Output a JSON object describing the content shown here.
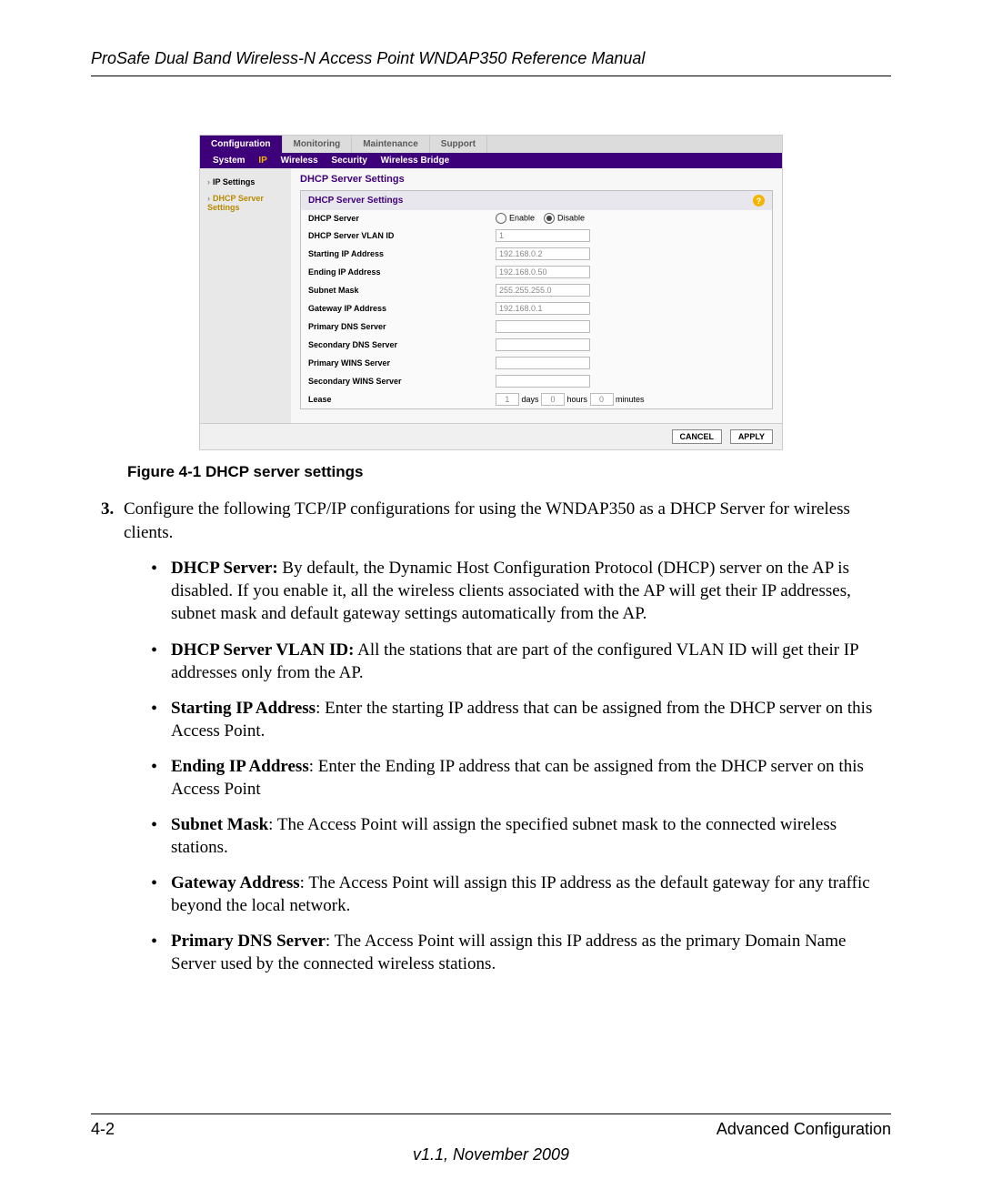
{
  "header": "ProSafe Dual Band Wireless-N Access Point WNDAP350 Reference Manual",
  "shot": {
    "tabs": [
      "Configuration",
      "Monitoring",
      "Maintenance",
      "Support"
    ],
    "tabs_active": 0,
    "subtabs": [
      "System",
      "IP",
      "Wireless",
      "Security",
      "Wireless Bridge"
    ],
    "subtabs_active": 1,
    "sidebar": [
      {
        "label": "IP Settings",
        "selected": false
      },
      {
        "label": "DHCP Server Settings",
        "selected": true
      }
    ],
    "title": "DHCP Server Settings",
    "panel_title": "DHCP Server Settings",
    "rows": {
      "dhcp_server_label": "DHCP Server",
      "enable": "Enable",
      "disable": "Disable",
      "vlan_label": "DHCP Server VLAN ID",
      "vlan_val": "1",
      "start_label": "Starting IP Address",
      "start_val": "192.168.0.2",
      "end_label": "Ending IP Address",
      "end_val": "192.168.0.50",
      "mask_label": "Subnet Mask",
      "mask_val": "255.255.255.0",
      "gw_label": "Gateway IP Address",
      "gw_val": "192.168.0.1",
      "pdns_label": "Primary DNS Server",
      "sdns_label": "Secondary DNS Server",
      "pwins_label": "Primary WINS Server",
      "swins_label": "Secondary WINS Server",
      "lease_label": "Lease",
      "lease_days": "1",
      "days": "days",
      "lease_hours": "0",
      "hours": "hours",
      "lease_min": "0",
      "min": "minutes"
    },
    "buttons": {
      "cancel": "CANCEL",
      "apply": "APPLY"
    }
  },
  "caption": "Figure 4-1  DHCP server settings",
  "list_start": "3",
  "step3": "Configure the following TCP/IP configurations for using the WNDAP350 as a DHCP Server for wireless clients.",
  "bullets": [
    {
      "b": "DHCP Server:",
      "t": " By default, the Dynamic Host Configuration Protocol (DHCP) server on the AP is disabled. If you enable it, all the wireless clients associated with the AP will get their IP addresses, subnet mask and default gateway settings automatically from the AP."
    },
    {
      "b": "DHCP Server VLAN ID:",
      "t": " All the stations that are part of the configured VLAN ID will get their IP addresses only from the AP."
    },
    {
      "b": "Starting IP Address",
      "t": ": Enter the starting IP address that can be assigned from the DHCP server on this Access Point."
    },
    {
      "b": "Ending IP Address",
      "t": ": Enter the Ending IP address that can be assigned from the DHCP server on this Access Point"
    },
    {
      "b": "Subnet Mask",
      "t": ": The Access Point will assign the specified subnet mask to the connected wireless stations."
    },
    {
      "b": "Gateway Address",
      "t": ": The Access Point will assign this IP address as the default gateway for any traffic beyond the local network."
    },
    {
      "b": "Primary DNS Server",
      "t": ": The Access Point will assign this IP address as the primary Domain Name Server used by the connected wireless stations."
    }
  ],
  "footer": {
    "left": "4-2",
    "right": "Advanced Configuration",
    "center": "v1.1, November 2009"
  }
}
